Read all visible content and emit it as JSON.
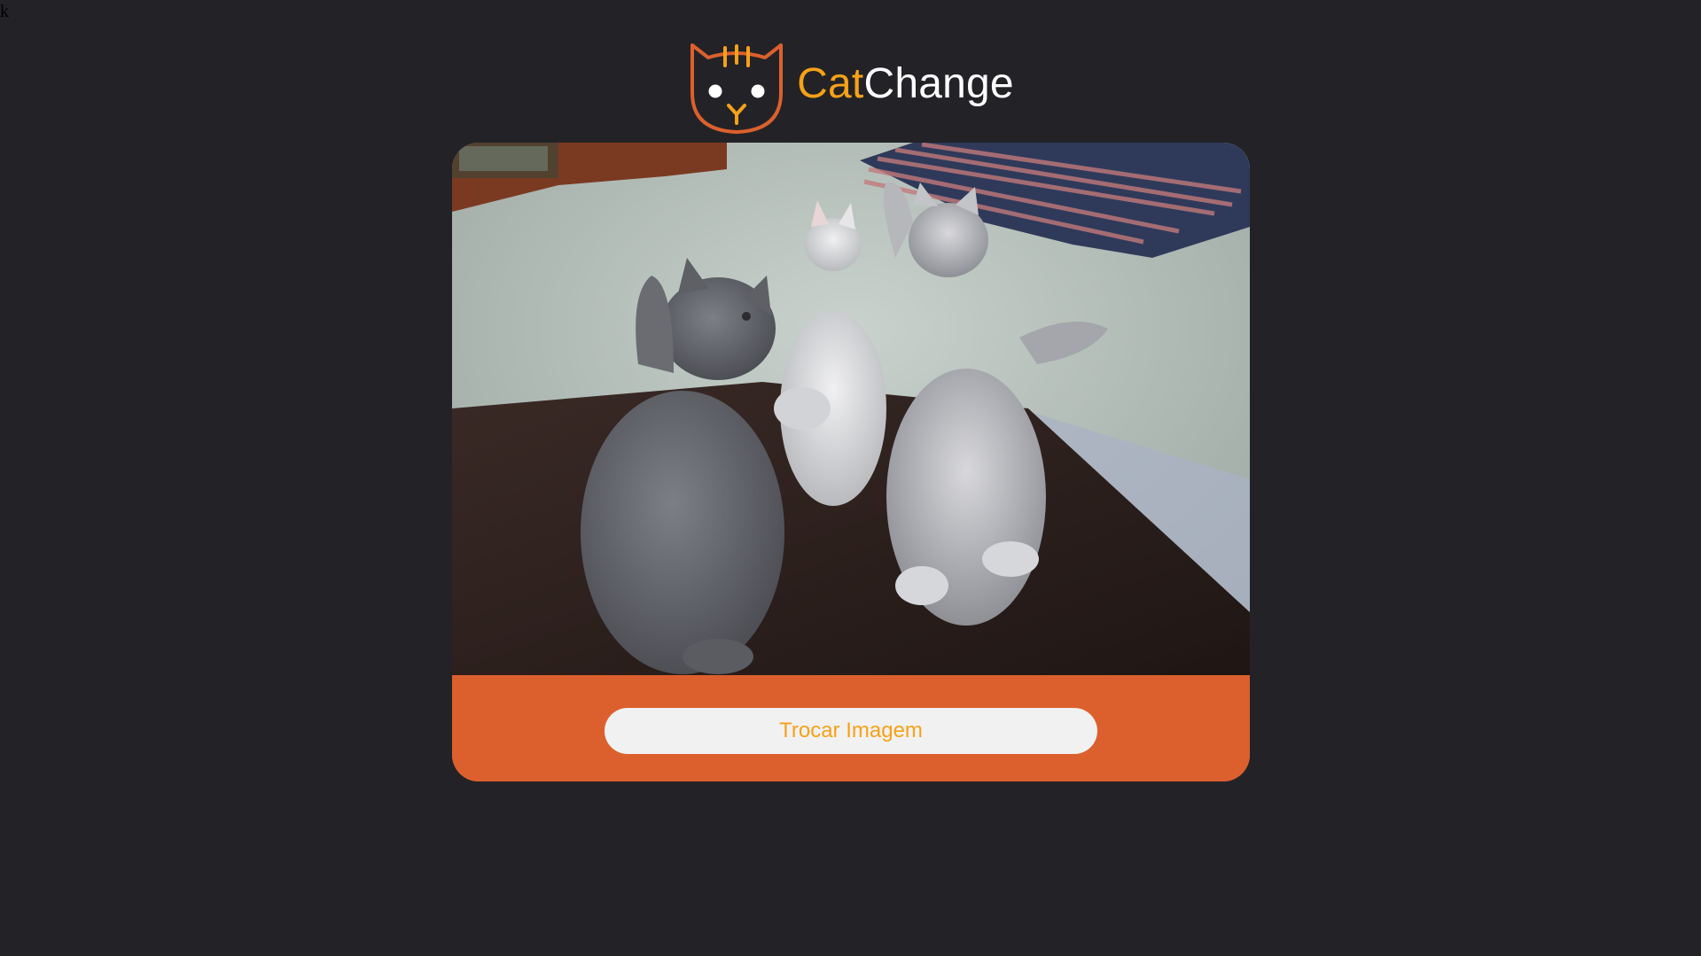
{
  "page": {
    "stray_text": "k"
  },
  "header": {
    "logo_icon": "cat-face-icon",
    "brand_part1": "Cat",
    "brand_part2": "Change"
  },
  "card": {
    "image_alt": "kittens-photo",
    "button_label": "Trocar Imagem"
  },
  "colors": {
    "background": "#232327",
    "accent_orange": "#f6a118",
    "card_footer": "#dc602e",
    "button_bg": "#f1f1f1",
    "brand_white": "#ffffff"
  }
}
